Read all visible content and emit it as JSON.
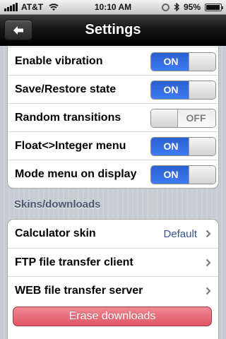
{
  "status_bar": {
    "carrier": "AT&T",
    "time": "10:10 AM",
    "battery_percent": "95%",
    "battery_level": 0.95,
    "icons": [
      "signal-icon",
      "wifi-icon",
      "lock-rotation-icon",
      "bluetooth-icon",
      "battery-icon"
    ]
  },
  "nav": {
    "title": "Settings",
    "back_icon": "back-arrow-icon"
  },
  "settings": {
    "toggles": [
      {
        "label": "Enable vibration",
        "state": "ON"
      },
      {
        "label": "Save/Restore state",
        "state": "ON"
      },
      {
        "label": "Random transitions",
        "state": "OFF"
      },
      {
        "label": "Float<>Integer menu",
        "state": "ON"
      },
      {
        "label": "Mode menu on display",
        "state": "ON"
      }
    ],
    "on_label": "ON",
    "off_label": "OFF"
  },
  "downloads": {
    "header": "Skins/downloads",
    "rows": [
      {
        "label": "Calculator skin",
        "value": "Default"
      },
      {
        "label": "FTP file transfer client",
        "value": ""
      },
      {
        "label": "WEB file transfer server",
        "value": ""
      }
    ],
    "erase_label": "Erase downloads"
  },
  "colors": {
    "accent_on": "#3d7cf1",
    "erase_button": "#e25564",
    "value_text": "#385487"
  }
}
